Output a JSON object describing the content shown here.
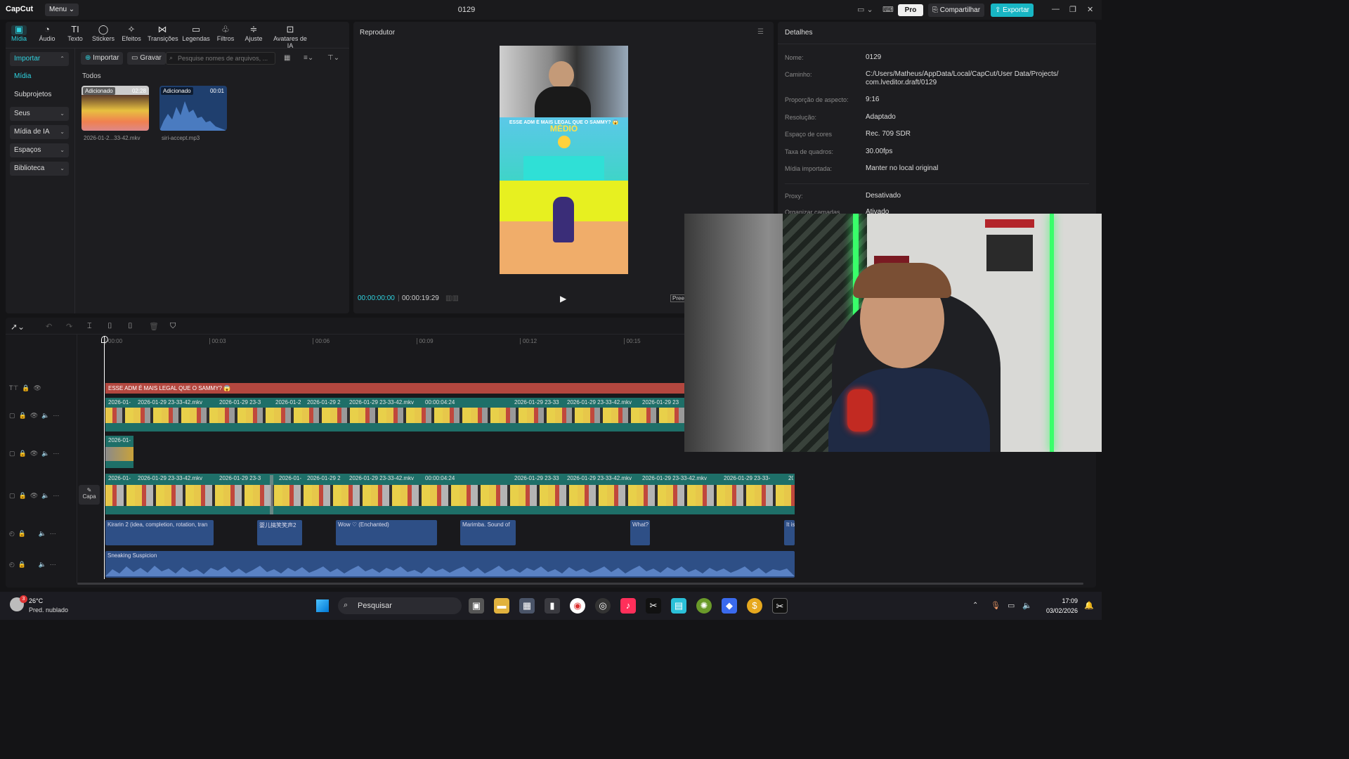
{
  "app": {
    "logo": "CapCut",
    "menu": "Menu",
    "project_title": "0129",
    "pro": "Pro",
    "share": "Compartilhar",
    "export": "Exportar"
  },
  "toolbar_tabs": [
    {
      "label": "Mídia",
      "icon": "media-icon",
      "glyph": "▣"
    },
    {
      "label": "Áudio",
      "icon": "audio-icon",
      "glyph": "◔"
    },
    {
      "label": "Texto",
      "icon": "text-icon",
      "glyph": "TI"
    },
    {
      "label": "Stickers",
      "icon": "sticker-icon",
      "glyph": "◯"
    },
    {
      "label": "Efeitos",
      "icon": "effects-icon",
      "glyph": "✧"
    },
    {
      "label": "Transições",
      "icon": "transition-icon",
      "glyph": "⋈"
    },
    {
      "label": "Legendas",
      "icon": "captions-icon",
      "glyph": "▭"
    },
    {
      "label": "Filtros",
      "icon": "filter-icon",
      "glyph": "♧"
    },
    {
      "label": "Ajuste",
      "icon": "adjust-icon",
      "glyph": "≑"
    },
    {
      "label": "Avatares de IA",
      "icon": "avatar-icon",
      "glyph": "⊡"
    }
  ],
  "sidebar": {
    "importar": "Importar",
    "items": [
      "Mídia",
      "Subprojetos"
    ],
    "groups": [
      "Seus",
      "Mídia de IA",
      "Espaços",
      "Biblioteca"
    ]
  },
  "media": {
    "import_btn": "Importar",
    "record_btn": "Gravar",
    "search_placeholder": "Pesquise nomes de arquivos, ...",
    "filter_label": "Todos",
    "items": [
      {
        "badge": "Adicionado",
        "duration": "02:28",
        "name": "2026-01-2...33-42.mkv"
      },
      {
        "badge": "Adicionado",
        "duration": "00:01",
        "name": "siri-accept.mp3"
      }
    ]
  },
  "player": {
    "title": "Reprodutor",
    "current_time": "00:00:00:00",
    "total_time": "00:00:19:29",
    "preview_caption": "ESSE ADM É MAIS LEGAL QUE O SAMMY? 😱",
    "preview_level": "MÉDIO",
    "preview_btn": "Pree"
  },
  "details": {
    "title": "Detalhes",
    "rows": [
      {
        "label": "Nome:",
        "value": "0129"
      },
      {
        "label": "Caminho:",
        "value": "C:/Users/Matheus/AppData/Local/CapCut/User Data/Projects/"
      },
      {
        "label": "",
        "value": "com.lveditor.draft/0129"
      },
      {
        "label": "Proporção de aspecto:",
        "value": "9:16"
      },
      {
        "label": "Resolução:",
        "value": "Adaptado"
      },
      {
        "label": "Espaço de cores",
        "value": "Rec. 709 SDR"
      },
      {
        "label": "Taxa de quadros:",
        "value": "30.00fps"
      },
      {
        "label": "Mídia importada:",
        "value": "Manter no local original"
      },
      {
        "label": "Proxy:",
        "value": "Desativado"
      },
      {
        "label": "Organizar camadas",
        "value": "Ativado"
      }
    ]
  },
  "timeline": {
    "ruler": [
      "00:00",
      "00:03",
      "00:06",
      "00:09",
      "00:12",
      "00:15"
    ],
    "text_clip": "ESSE ADM É MAIS LEGAL QUE O SAMMY? 😱",
    "video_labels_1": [
      "2026-01-",
      "2026-01-29 23-33-42.mkv",
      "2026-01-29 23-3",
      "2026-01-2",
      "2026-01-29 2",
      "2026-01-29 23-33-42.mkv",
      "00:00:04:24",
      "2026-01-29 23-33",
      "2026-01-29 23-33-42.mkv",
      "2026-01-29 23"
    ],
    "overlay_label": "2026-01-",
    "video_labels_main": [
      "2026-01-",
      "2026-01-29 23-33-42.mkv",
      "2026-01-29 23-3",
      "2026-01-",
      "2026-01-29 2",
      "2026-01-29 23-33-42.mkv",
      "00:00:04:24",
      "2026-01-29 23-33",
      "2026-01-29 23-33-42.mkv",
      "2026-01-29 23-33-42.mkv",
      "2026-01-29 23-33-",
      "20"
    ],
    "cover": "Capa",
    "audio_clips": [
      "Kirarin 2 (idea, completion, rotation, tran",
      "婴儿搞笑笑声2",
      "Wow ♡ (Enchanted)",
      "Marimba. Sound of",
      "What?",
      "It is"
    ],
    "music_clip": "Sneaking Suspicion"
  },
  "taskbar": {
    "weather_temp": "26°C",
    "weather_desc": "Pred. nublado",
    "weather_badge": "3",
    "search": "Pesquisar",
    "time": "17:09",
    "date": "03/02/2026"
  }
}
